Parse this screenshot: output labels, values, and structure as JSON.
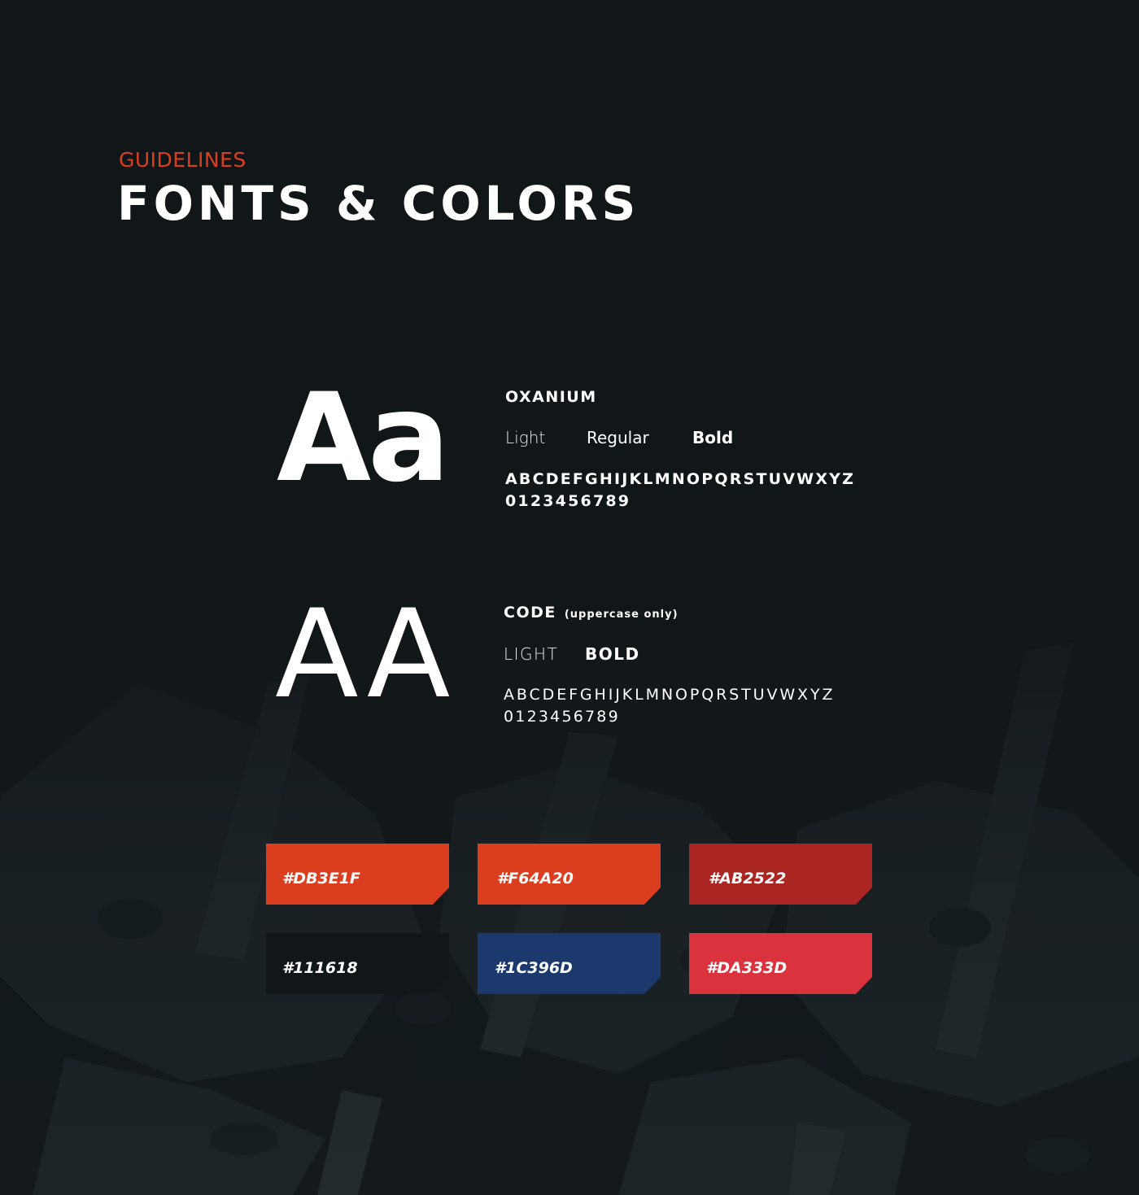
{
  "header": {
    "eyebrow": "GUIDELINES",
    "title": "FONTS & COLORS"
  },
  "fonts": [
    {
      "specimen": "Aa",
      "name": "OXANIUM",
      "note": "",
      "weights": [
        "Light",
        "Regular",
        "Bold"
      ],
      "alphabet": "ABCDEFGHIJKLMNOPQRSTUVWXYZ",
      "digits": "0123456789"
    },
    {
      "specimen": "AA",
      "name": "CODE",
      "note": "(uppercase only)",
      "weights": [
        "LIGHT",
        "BOLD"
      ],
      "alphabet": "ABCDEFGHIJKLMNOPQRSTUVWXYZ",
      "digits": "0123456789"
    }
  ],
  "palette": [
    {
      "label": "#DB3E1F",
      "color": "#DB3E1F"
    },
    {
      "label": "#F64A20",
      "color": "#DB3E1F"
    },
    {
      "label": "#AB2522",
      "color": "#AB2522"
    },
    {
      "label": "#111618",
      "color": "#111618"
    },
    {
      "label": "#1C396D",
      "color": "#1C396D"
    },
    {
      "label": "#DA333D",
      "color": "#DA333D"
    }
  ]
}
